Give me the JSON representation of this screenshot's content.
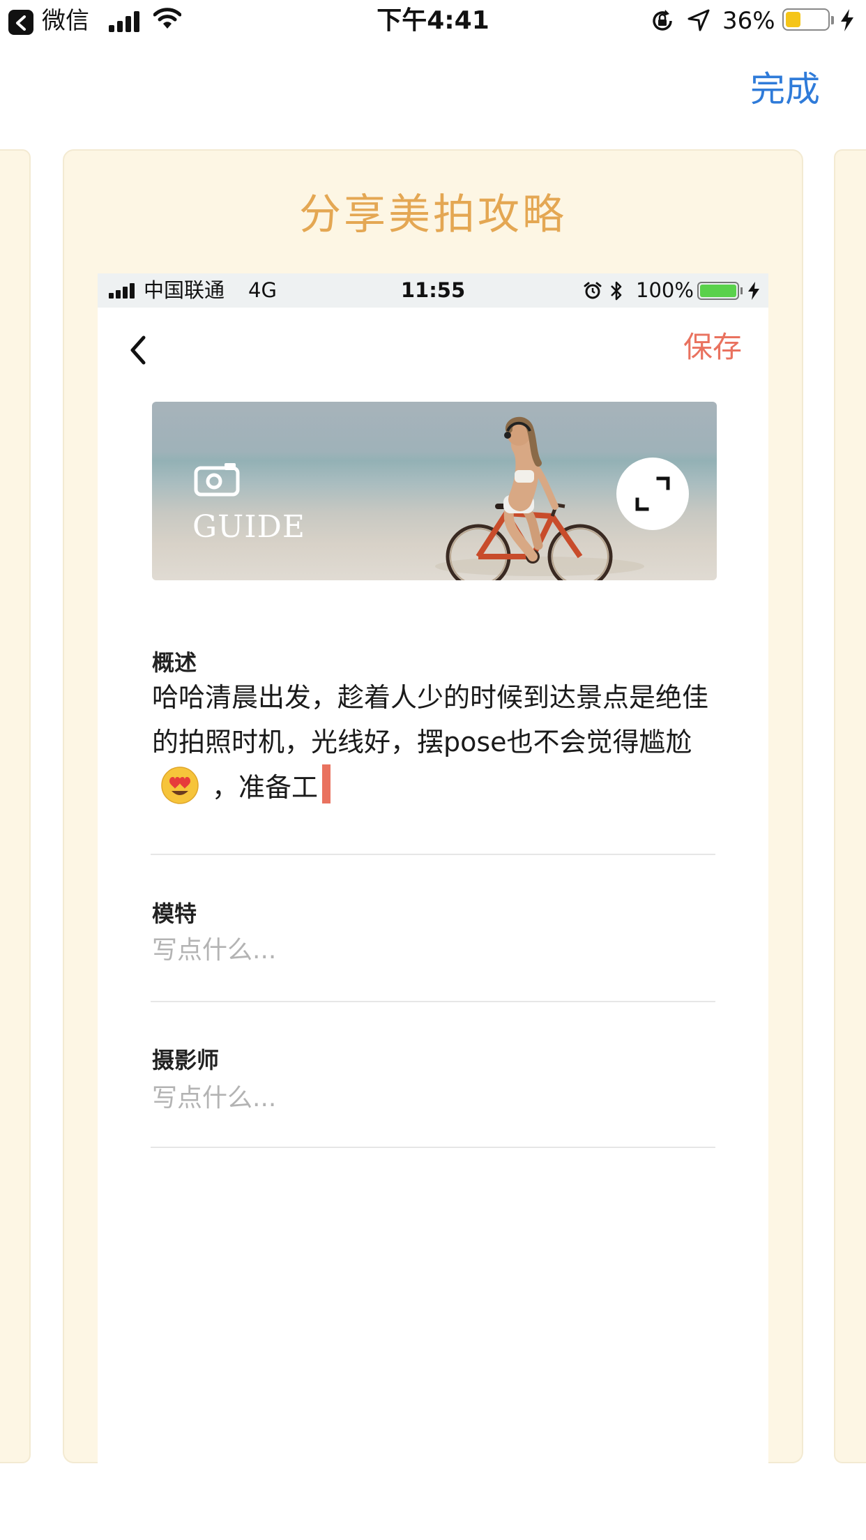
{
  "status_bar": {
    "back_app": "微信",
    "time": "下午4:41",
    "battery_pct": "36%",
    "battery_level": 0.36,
    "battery_color": "#f5c518"
  },
  "nav": {
    "done": "完成",
    "done_color": "#2f7bd9"
  },
  "card": {
    "title": "分享美拍攻略",
    "title_color": "#e4a753",
    "background": "#fdf6e4"
  },
  "inner_status_bar": {
    "carrier": "中国联通",
    "network": "4G",
    "time": "11:55",
    "battery_pct": "100%",
    "battery_level": 1.0,
    "battery_color": "#5ad14b"
  },
  "inner_nav": {
    "back_icon": "chevron-left-icon",
    "save": "保存",
    "save_color": "#e9725f"
  },
  "banner": {
    "label": "GUIDE",
    "camera_icon": "camera-icon",
    "expand_icon": "expand-icon"
  },
  "fields": {
    "overview": {
      "label": "概述",
      "value_before_emoji": "哈哈清晨出发，趁着人少的时候到达景点是绝佳的拍照时机，光线好，摆pose也不会觉得尴尬",
      "emoji": "heart-eyes-emoji",
      "value_after_emoji": "，准备工"
    },
    "model": {
      "label": "模特",
      "placeholder": "写点什么..."
    },
    "photographer": {
      "label": "摄影师",
      "placeholder": "写点什么..."
    }
  }
}
